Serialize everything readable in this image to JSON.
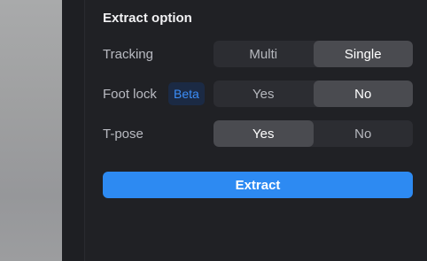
{
  "panel": {
    "title": "Extract option",
    "rows": [
      {
        "label": "Tracking",
        "options": [
          "Multi",
          "Single"
        ],
        "selected": "Single"
      },
      {
        "label": "Foot lock",
        "badge": "Beta",
        "options": [
          "Yes",
          "No"
        ],
        "selected": "No"
      },
      {
        "label": "T-pose",
        "options": [
          "Yes",
          "No"
        ],
        "selected": "Yes"
      }
    ],
    "extract_label": "Extract"
  },
  "colors": {
    "accent": "#2d8af2",
    "badge_text": "#3b8df7",
    "panel_bg": "#202125",
    "segment_bg": "#2c2d32",
    "segment_active": "#4a4b50"
  }
}
